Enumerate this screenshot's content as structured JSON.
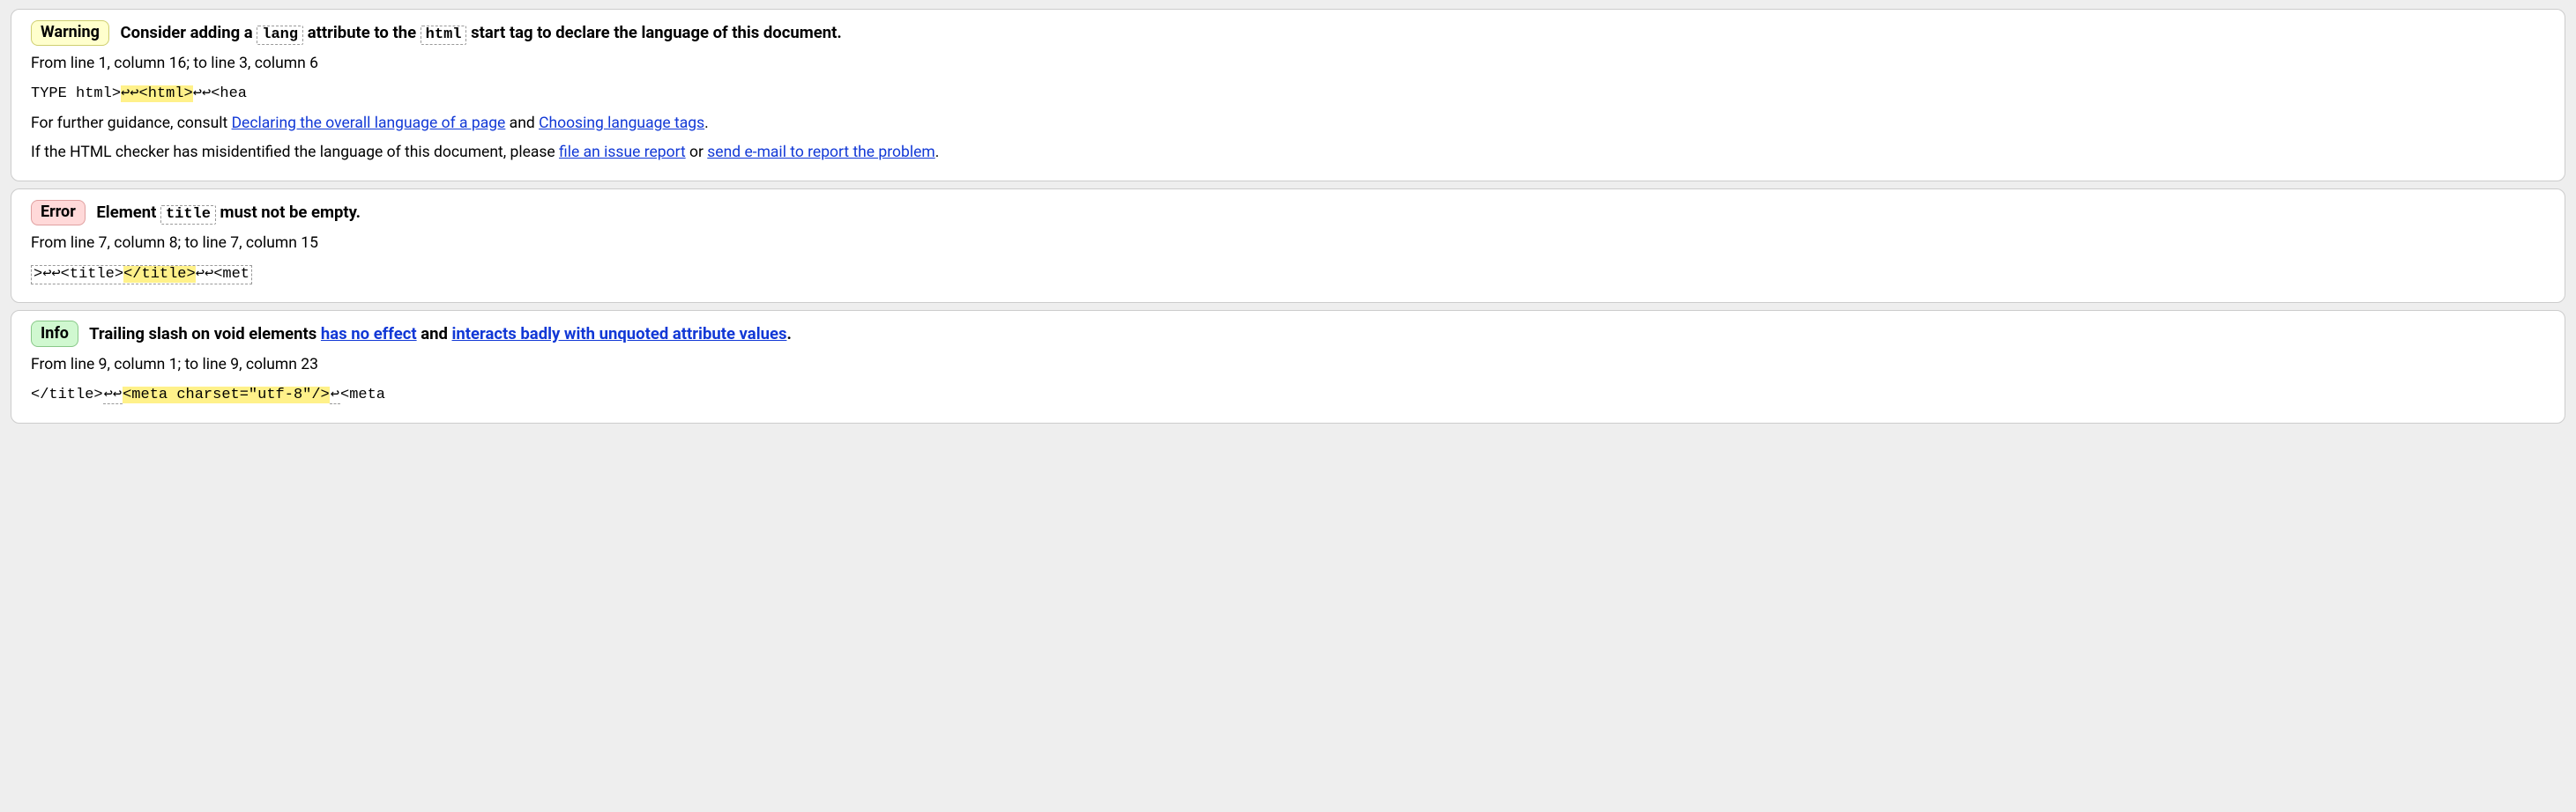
{
  "badges": {
    "warning": "Warning",
    "error": "Error",
    "info": "Info"
  },
  "msg1": {
    "text_a": " Consider adding a ",
    "code_a": "lang",
    "text_b": " attribute to the ",
    "code_b": "html",
    "text_c": " start tag to declare the language of this document.",
    "loc": "From line 1, column 16; to line 3, column 6",
    "ex_a": "TYPE html>",
    "ex_hl": "↩↩<html>",
    "ex_b": "↩↩<hea",
    "g_a": "For further guidance, consult ",
    "g_link1": "Declaring the overall language of a page",
    "g_b": " and ",
    "g_link2": "Choosing language tags",
    "g_c": ".",
    "mis_a": "If the HTML checker has misidentified the language of this document, please ",
    "mis_link1": "file an issue report",
    "mis_b": " or ",
    "mis_link2": "send e-mail to report the problem",
    "mis_c": "."
  },
  "msg2": {
    "text_a": " Element ",
    "code_a": "title",
    "text_b": " must not be empty.",
    "loc": "From line 7, column 8; to line 7, column 15",
    "ex_a": ">↩↩<title>",
    "ex_hl": "</title>",
    "ex_b": "↩↩<met"
  },
  "msg3": {
    "text_a": " Trailing slash on void elements ",
    "link_a": "has no effect",
    "text_b": " and ",
    "link_b": "interacts badly with unquoted attribute values",
    "text_c": ".",
    "loc": "From line 9, column 1; to line 9, column 23",
    "ex_a": "</title>",
    "ex_nl": "↩↩",
    "ex_hl": "<meta charset=\"utf-8\"/>",
    "ex_nl2": "↩",
    "ex_b": "<meta"
  }
}
